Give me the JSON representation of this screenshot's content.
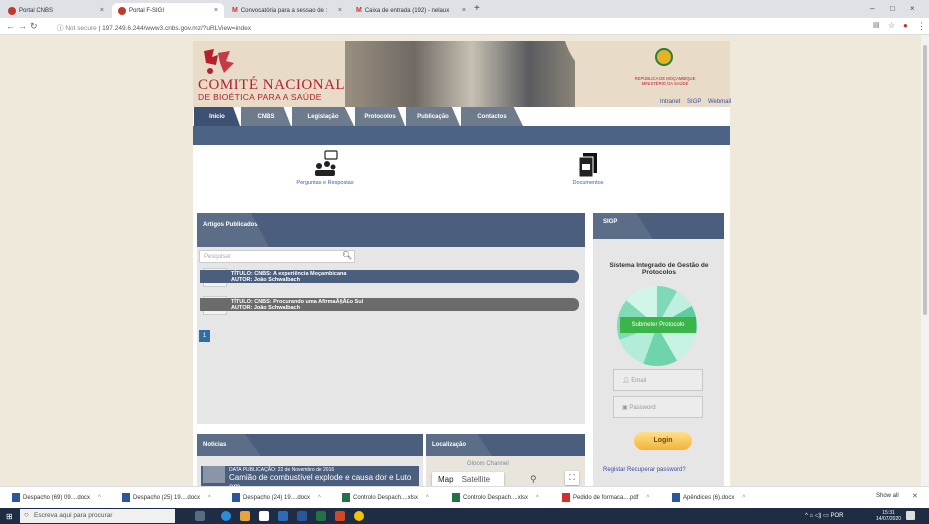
{
  "browser": {
    "tabs": [
      {
        "label": "Portal CNBS",
        "active": false
      },
      {
        "label": "Portal F-SIGI",
        "active": true
      },
      {
        "label": "Convocatória para a sessao de :",
        "active": false
      },
      {
        "label": "Caixa de entrada (192) - nelaux",
        "active": false
      }
    ],
    "new_tab": "+",
    "security": "Not secure",
    "url": "197.249.6.244/www3.cnbs.gov.mz/?uRLView=index",
    "window_controls": [
      "–",
      "□",
      "×"
    ]
  },
  "site": {
    "title_line1": "COMITÉ NACIONAL",
    "title_line2": "DE BIOÉTICA PARA A SAÚDE",
    "republic": "REPÚBLICA DE MOÇAMBIQUE",
    "ministry": "MINISTÉRIO DA SAÚDE",
    "toplinks": [
      "Intranet",
      "SIGP",
      "Webmail"
    ],
    "nav": [
      "Inicio",
      "CNBS",
      "Legislação",
      "Protocolos",
      "Publicação",
      "Contactos"
    ],
    "quick_links": [
      {
        "label": "Perguntas e Respostas",
        "icon": "qa-people-icon"
      },
      {
        "label": "Documentos",
        "icon": "documents-icon"
      }
    ]
  },
  "articles": {
    "title": "Artigos Publicados",
    "search_placeholder": "Pesquisar",
    "items": [
      {
        "title": "TÍTULO: CNBS: A experiência Moçambicana",
        "author": "AUTOR: João Schwalbach",
        "color": "#4b5e7e"
      },
      {
        "title": "TÍTULO: CNBS: Procurando uma AfirmaÃ§Ã£o Sul",
        "author": "AUTOR: João Schwalbach",
        "color": "#6b6b6b"
      }
    ],
    "page": "1"
  },
  "news": {
    "title": "Noticias",
    "item_date": "DATA PUBLICAÇÃO: 22 de Novembro de 2016",
    "item_title": "Camião de combustível explode e causa dor e Luto em"
  },
  "location": {
    "title": "Localização",
    "map_label": "Map",
    "satellite_label": "Satellite",
    "place": "Gloom Channel"
  },
  "sigp": {
    "tab": "SIGP",
    "title": "Sistema Integrado de Gestão de Protocolos",
    "submit": "Submeter Protocolo",
    "email_placeholder": "Email",
    "password_placeholder": "Password",
    "login": "Login",
    "register": "Registar",
    "recover": "Recuperar password?"
  },
  "downloads": [
    {
      "label": "Despacho (69) 09....docx",
      "icon_color": "#2b579a"
    },
    {
      "label": "Despacho (25) 19....docx",
      "icon_color": "#2b579a"
    },
    {
      "label": "Despacho (24) 19....docx",
      "icon_color": "#2b579a"
    },
    {
      "label": "Controlo Despach....xlsx",
      "icon_color": "#217346"
    },
    {
      "label": "Controlo Despach....xlsx",
      "icon_color": "#217346"
    },
    {
      "label": "Pedido de formaca....pdf",
      "icon_color": "#d32f2f"
    },
    {
      "label": "Apêndices (6).docx",
      "icon_color": "#2b579a"
    }
  ],
  "downloads_show_all": "Show all",
  "taskbar": {
    "search_placeholder": "Escreva aqui para procurar",
    "lang": "POR",
    "time": "15:31",
    "date": "14/07/2020"
  }
}
